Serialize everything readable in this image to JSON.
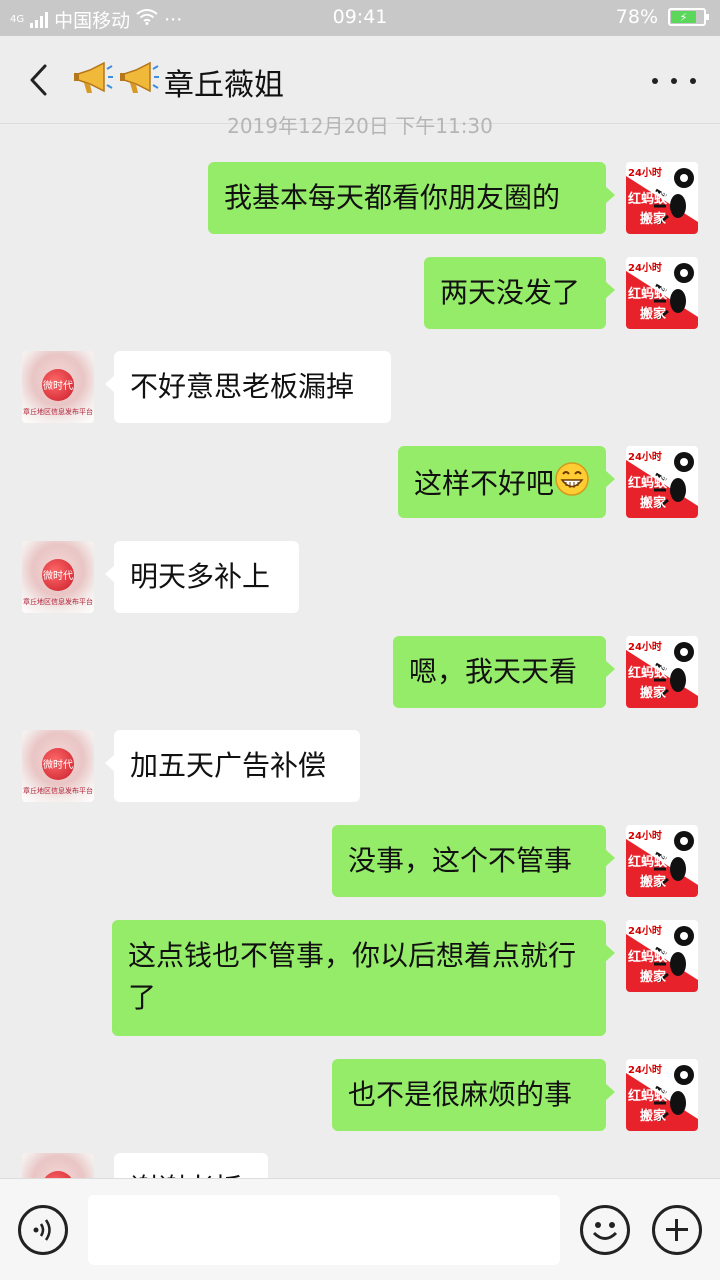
{
  "status": {
    "network_tag": "4G",
    "carrier": "中国移动",
    "overflow": "···",
    "time": "09:41",
    "battery": "78%",
    "battery_level": 0.78
  },
  "header": {
    "back_icon": "chevron-left-icon",
    "contact_prefix_icons": [
      "megaphone-icon",
      "megaphone-icon"
    ],
    "contact_name": "章丘薇姐",
    "more_icon": "more-dots-icon"
  },
  "timestamp": "2019年12月20日 下午11:30",
  "avatars": {
    "me": {
      "line1": "24小时",
      "line2": "红蚂蚁",
      "line3": "搬家"
    },
    "other": {
      "line1": "微时代",
      "line2": "章丘地区信息发布平台"
    }
  },
  "messages": [
    {
      "from": "me",
      "text": "我基本每天都看你朋友圈的"
    },
    {
      "from": "me",
      "text": "两天没发了"
    },
    {
      "from": "other",
      "text": "不好意思老板漏掉"
    },
    {
      "from": "me",
      "text": "这样不好吧",
      "emoji": "grin-emoji"
    },
    {
      "from": "other",
      "text": "明天多补上"
    },
    {
      "from": "me",
      "text": "嗯，我天天看"
    },
    {
      "from": "other",
      "text": "加五天广告补偿"
    },
    {
      "from": "me",
      "text": "没事，这个不管事"
    },
    {
      "from": "me",
      "text": "这点钱也不管事，你以后想着点就行了"
    },
    {
      "from": "me",
      "text": "也不是很麻烦的事"
    },
    {
      "from": "other",
      "text": "谢谢老板"
    }
  ],
  "input": {
    "value": "",
    "voice_icon": "voice-icon",
    "emoji_icon": "emoji-icon",
    "plus_icon": "plus-icon"
  },
  "colors": {
    "my_bubble": "#95ec69",
    "their_bubble": "#ffffff",
    "background": "#ededed"
  }
}
